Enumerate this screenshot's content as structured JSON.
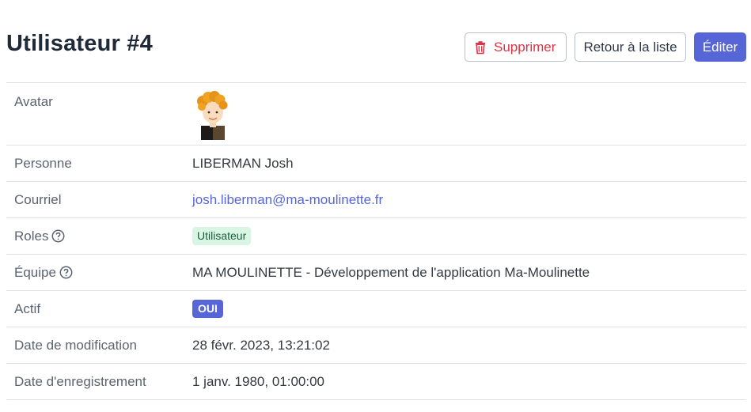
{
  "page_title": "Utilisateur #4",
  "buttons": {
    "delete": "Supprimer",
    "back": "Retour à la liste",
    "edit": "Éditer"
  },
  "icons": {
    "delete": "trash-icon",
    "help": "question-circle-icon",
    "avatar": "cartoon-avatar"
  },
  "fields": {
    "avatar": {
      "label": "Avatar"
    },
    "personne": {
      "label": "Personne",
      "value": "LIBERMAN Josh"
    },
    "courriel": {
      "label": "Courriel",
      "value": "josh.liberman@ma-moulinette.fr"
    },
    "roles": {
      "label": "Roles",
      "value": "Utilisateur"
    },
    "equipe": {
      "label": "Équipe",
      "value": "MA MOULINETTE - Développement de l'application Ma-Moulinette"
    },
    "actif": {
      "label": "Actif",
      "value": "OUI"
    },
    "date_modification": {
      "label": "Date de modification",
      "value": "28 févr. 2023, 13:21:02"
    },
    "date_enregistrement": {
      "label": "Date d'enregistrement",
      "value": "1 janv. 1980, 01:00:00"
    }
  },
  "colors": {
    "primary": "#5766d6",
    "danger": "#dc3545",
    "role_badge_bg": "#d8f6e3",
    "role_badge_text": "#1f5c3a"
  }
}
